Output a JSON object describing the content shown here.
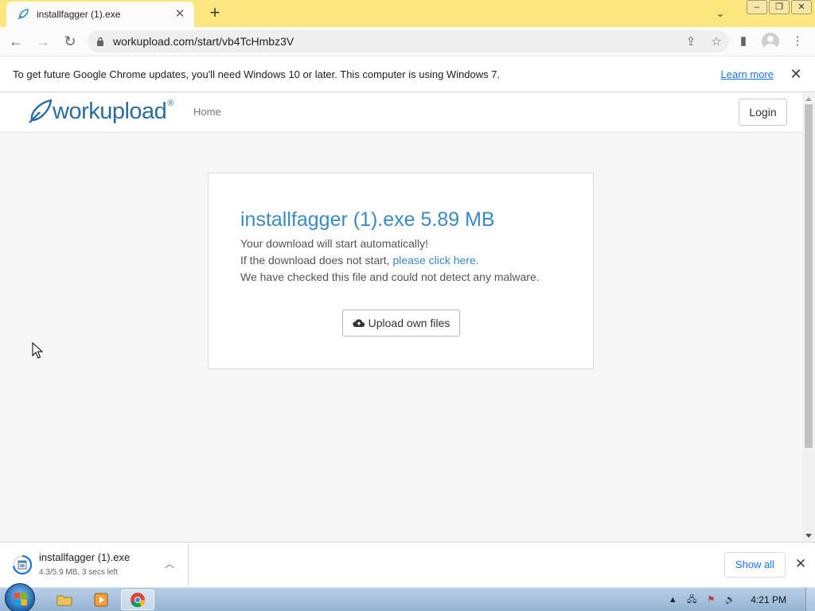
{
  "tab": {
    "title": "installfagger (1).exe",
    "close": "✕",
    "new_tab": "+"
  },
  "toolbar": {
    "back": "←",
    "forward": "→",
    "reload": "↻",
    "url": "workupload.com/start/vb4TcHmbz3V"
  },
  "infobar": {
    "message": "To get future Google Chrome updates, you'll need Windows 10 or later. This computer is using Windows 7.",
    "link": "Learn more",
    "close": "✕"
  },
  "site": {
    "logo": "workupload",
    "logo_mark": "®",
    "nav_home": "Home",
    "login": "Login"
  },
  "card": {
    "title": "installfagger (1).exe 5.89 MB",
    "line1": "Your download will start automatically!",
    "line2_prefix": "If the download does not start, ",
    "line2_link": "please click here",
    "line2_suffix": ".",
    "line3": "We have checked this file and could not detect any malware.",
    "upload_button": "Upload own files"
  },
  "download_shelf": {
    "file_name": "installfagger (1).exe",
    "status": "4.3/5.9 MB, 3 secs left",
    "progress": 0.73,
    "show_all": "Show all",
    "close": "✕"
  },
  "taskbar": {
    "time": "4:21 PM",
    "apps": [
      "explorer-icon",
      "media-player-icon",
      "chrome-icon"
    ]
  },
  "colors": {
    "tabstrip": "#fbe680",
    "link_blue": "#3a8ac4",
    "chrome_blue": "#1a73e8"
  }
}
